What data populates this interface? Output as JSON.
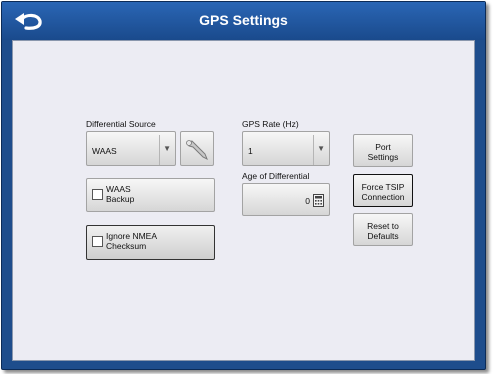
{
  "window": {
    "title": "GPS Settings",
    "back_icon": "back-arrow-icon"
  },
  "differential_source": {
    "label": "Differential Source",
    "value": "WAAS",
    "wrench_icon": "wrench-icon"
  },
  "gps_rate": {
    "label": "GPS Rate (Hz)",
    "value": "1"
  },
  "age_of_differential": {
    "label": "Age of Differential",
    "value": "0",
    "calc_icon": "calculator-icon"
  },
  "checkboxes": {
    "waas_backup": {
      "line1": "WAAS",
      "line2": "Backup",
      "checked": false
    },
    "ignore_nmea": {
      "line1": "Ignore NMEA",
      "line2": "Checksum",
      "checked": false
    }
  },
  "buttons": {
    "port_settings": {
      "line1": "Port",
      "line2": "Settings"
    },
    "force_tsip": {
      "line1": "Force TSIP",
      "line2": "Connection"
    },
    "reset_defaults": {
      "line1": "Reset to",
      "line2": "Defaults"
    }
  }
}
